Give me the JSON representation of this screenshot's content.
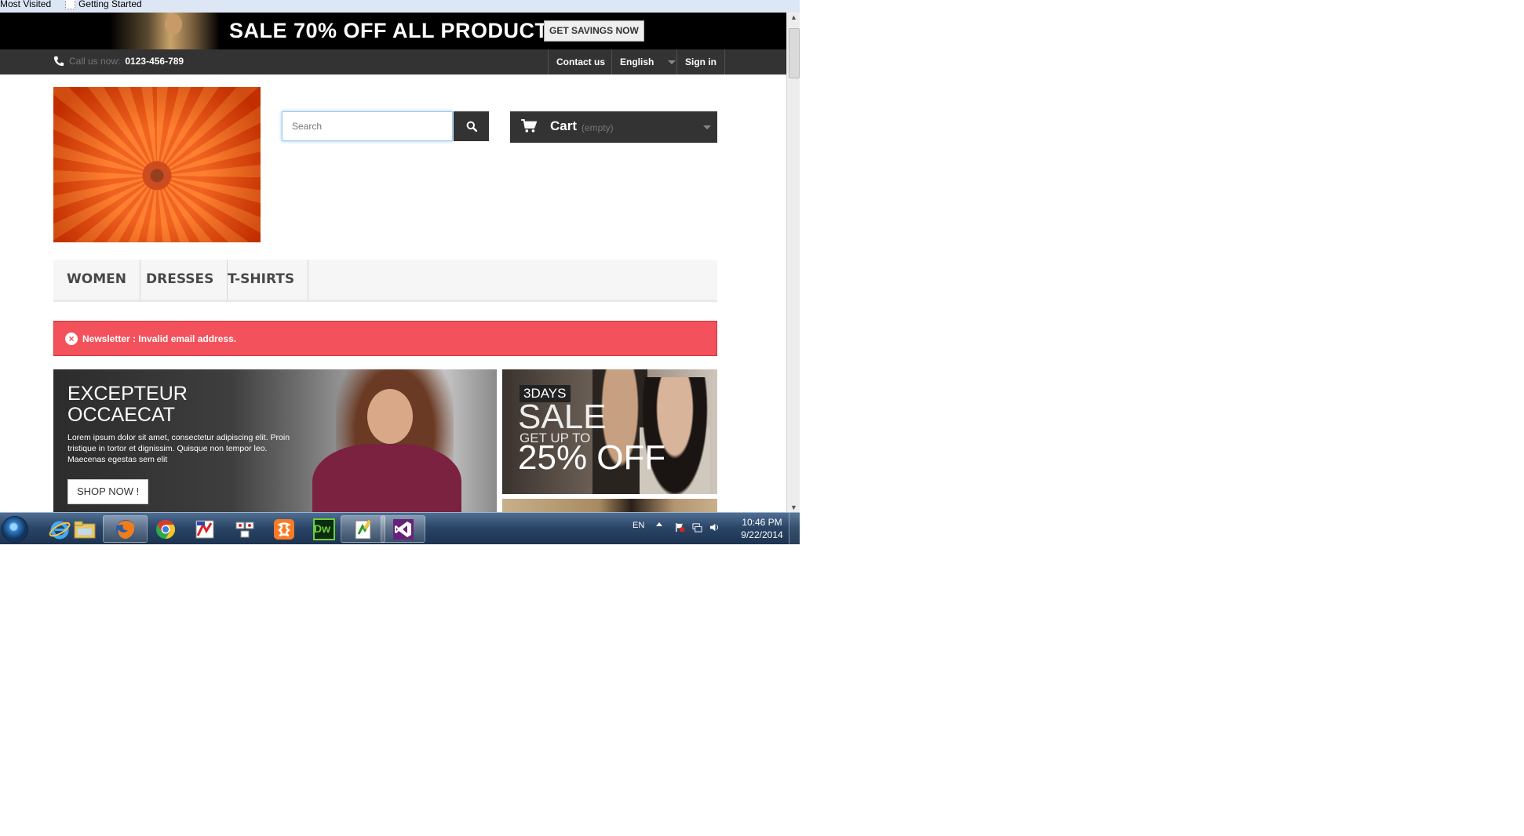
{
  "bookmarks": [
    {
      "label": "Most Visited"
    },
    {
      "label": "Getting Started"
    }
  ],
  "promo": {
    "text": "SALE 70% OFF ALL PRODUCTS",
    "button": "GET SAVINGS NOW"
  },
  "header": {
    "call_label": "Call us now:",
    "phone": "0123-456-789",
    "contact": "Contact us",
    "language": "English",
    "signin": "Sign in"
  },
  "search": {
    "placeholder": "Search"
  },
  "cart": {
    "label": "Cart",
    "status": "(empty)"
  },
  "menu": {
    "items": [
      "WOMEN",
      "DRESSES",
      "T-SHIRTS"
    ]
  },
  "alert": {
    "message": "Newsletter : Invalid email address."
  },
  "slider": {
    "title_line1": "EXCEPTEUR",
    "title_line2": "OCCAECAT",
    "description": "Lorem ipsum dolor sit amet, consectetur adipiscing elit. Proin tristique in tortor et dignissim. Quisque non tempor leo. Maecenas egestas sem elit",
    "button": "SHOP NOW !"
  },
  "banner": {
    "days": "3DAYS",
    "sale": "SALE",
    "get_up_to": "GET UP TO",
    "off": "25% OFF"
  },
  "taskbar": {
    "apps": [
      {
        "icon": "internet-explorer-icon"
      },
      {
        "icon": "file-explorer-icon"
      },
      {
        "icon": "firefox-icon"
      },
      {
        "icon": "chrome-icon"
      },
      {
        "icon": "app-red-icon"
      },
      {
        "icon": "app-network-icon"
      },
      {
        "icon": "xampp-icon"
      },
      {
        "icon": "dreamweaver-icon",
        "label": "Dw"
      },
      {
        "icon": "notepad-plus-icon"
      },
      {
        "icon": "visual-studio-icon"
      }
    ],
    "language": "EN",
    "time": "10:46 PM",
    "date": "9/22/2014"
  },
  "colors": {
    "alert": "#f3515c",
    "header_bar": "#333333",
    "taskbar": "#2a4566"
  }
}
